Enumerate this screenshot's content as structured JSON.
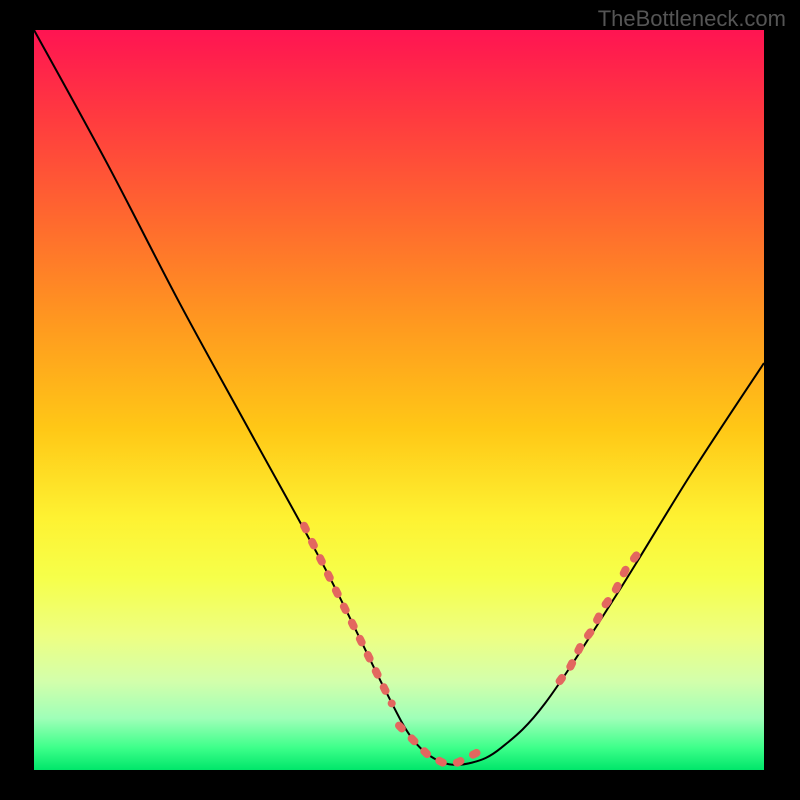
{
  "watermark": "TheBottleneck.com",
  "colors": {
    "top": "#ff1452",
    "bottom": "#00e66a",
    "curve": "#000000",
    "dots": "#e3675f",
    "frame": "#000000"
  },
  "chart_data": {
    "type": "line",
    "title": "",
    "xlabel": "",
    "ylabel": "",
    "xlim": [
      0,
      100
    ],
    "ylim": [
      0,
      100
    ],
    "grid": false,
    "legend": false,
    "series": [
      {
        "name": "bottleneck-curve",
        "x": [
          0,
          10,
          20,
          30,
          40,
          48,
          52,
          56,
          60,
          64,
          70,
          80,
          90,
          100
        ],
        "values": [
          100,
          82,
          63,
          45,
          27,
          11,
          4,
          1,
          1,
          3,
          9,
          24,
          40,
          55
        ]
      }
    ],
    "annotations": [
      {
        "name": "highlight-dots-left",
        "x": [
          37,
          38.5,
          40,
          41.5,
          43,
          44.5,
          46,
          47.5,
          49
        ],
        "values": [
          33,
          30,
          27,
          24,
          21,
          18,
          15,
          12,
          9
        ]
      },
      {
        "name": "highlight-dots-bottom",
        "x": [
          50,
          52,
          54,
          56,
          58,
          60,
          62
        ],
        "values": [
          6,
          4,
          2,
          1,
          1,
          2,
          3
        ]
      },
      {
        "name": "highlight-dots-right",
        "x": [
          72,
          73.5,
          75,
          76.5,
          78,
          79.5,
          81,
          82.5
        ],
        "values": [
          12,
          14,
          17,
          19,
          22,
          24,
          27,
          29
        ]
      }
    ]
  }
}
